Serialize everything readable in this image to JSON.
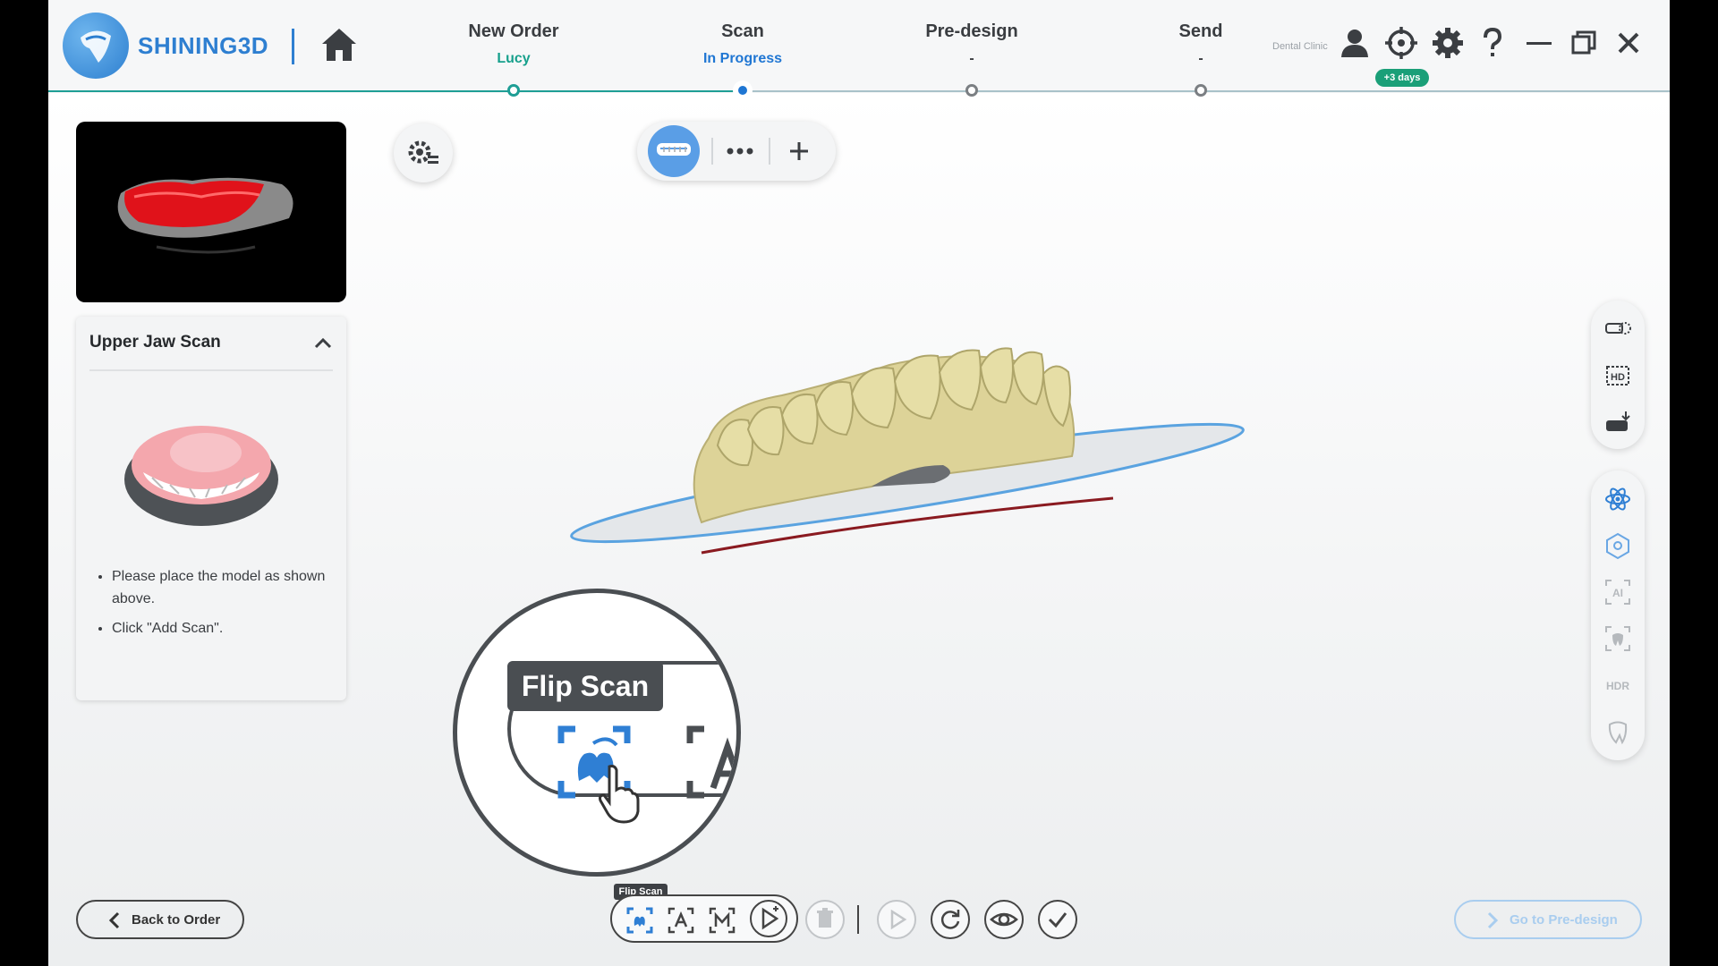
{
  "app": {
    "brand": "SHINING3D"
  },
  "header": {
    "steps": [
      {
        "title": "New Order",
        "subtitle": "Lucy"
      },
      {
        "title": "Scan",
        "subtitle": "In Progress"
      },
      {
        "title": "Pre-design",
        "subtitle": "-"
      },
      {
        "title": "Send",
        "subtitle": "-"
      }
    ],
    "clinic_label": "Dental Clinic",
    "license_badge": "+3 days",
    "colors": {
      "accent_green": "#1e9e95",
      "accent_blue": "#1f76d3"
    }
  },
  "left_panel": {
    "card_title": "Upper Jaw Scan",
    "instructions": [
      "Please place the model as shown above.",
      "Click \"Add Scan\"."
    ]
  },
  "magnifier": {
    "label": "Flip Scan"
  },
  "bottom_bar": {
    "back_label": "Back to Order",
    "next_label": "Go to Pre-design",
    "tooltip": "Flip Scan"
  },
  "side_toolbar": {
    "hdr_label": "HDR",
    "hd_label": "HD",
    "ai_label": "AI"
  }
}
